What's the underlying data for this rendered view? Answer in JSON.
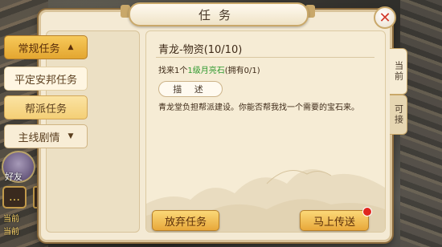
{
  "window": {
    "title": "任务"
  },
  "hud": {
    "friends_label": "好友",
    "current_label": "当前",
    "current_label2": "当前"
  },
  "tabs": [
    {
      "label": "常规任务",
      "state": "expanded",
      "chevron": "up"
    },
    {
      "label": "平定安邦任务",
      "state": "sub"
    },
    {
      "label": "帮派任务",
      "state": "sub-selected"
    },
    {
      "label": "主线剧情",
      "state": "collapsed",
      "chevron": "down"
    }
  ],
  "quest": {
    "title": "青龙-物资(10/10)",
    "requirement_prefix": "找来1个",
    "requirement_item": "1级月亮石",
    "requirement_suffix": "(拥有0/1)",
    "description_label": "描 述",
    "description": "青龙堂负担帮派建设。你能否帮我找一个需要的宝石来。"
  },
  "buttons": {
    "abandon": "放弃任务",
    "teleport": "马上传送"
  },
  "side_tabs": {
    "current": "当前",
    "available": "可接"
  },
  "colors": {
    "accent": "#e8a83a",
    "item_green": "#2f9a2f",
    "close_red": "#d23a2a"
  },
  "icons": {
    "close": "close-icon",
    "chat": "chat-icon",
    "chevron_up": "chevron-up-icon",
    "chevron_down": "chevron-down-icon"
  }
}
